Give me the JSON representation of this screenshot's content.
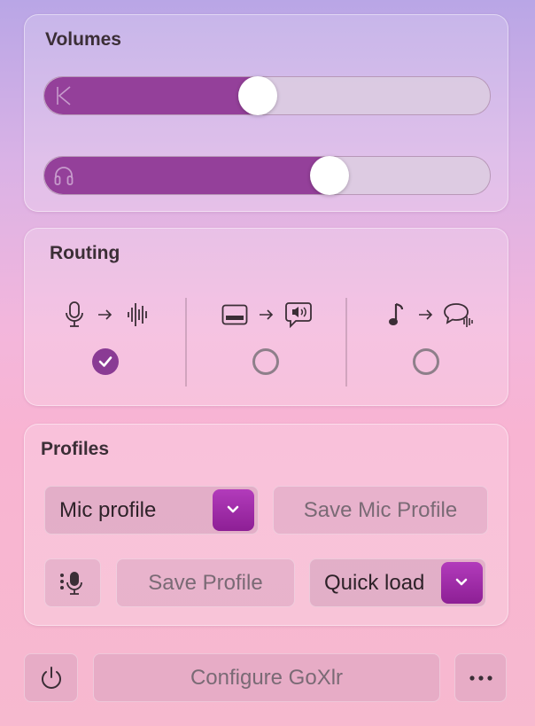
{
  "volumes": {
    "title": "Volumes",
    "sliders": [
      {
        "name": "system-volume",
        "icon": "k-icon",
        "level": 0.48
      },
      {
        "name": "headphones-volume",
        "icon": "headphones-icon",
        "level": 0.64
      }
    ]
  },
  "routing": {
    "title": "Routing",
    "routes": [
      {
        "from_icon": "microphone-icon",
        "to_icon": "waveform-icon",
        "selected": true
      },
      {
        "from_icon": "monitor-icon",
        "to_icon": "speaker-bubble-icon",
        "selected": false
      },
      {
        "from_icon": "music-note-icon",
        "to_icon": "chat-waveform-icon",
        "selected": false
      }
    ]
  },
  "profiles": {
    "title": "Profiles",
    "mic_profile_select": "Mic profile",
    "save_mic_profile": "Save Mic Profile",
    "save_profile": "Save Profile",
    "quick_load_select": "Quick load"
  },
  "footer": {
    "configure": "Configure GoXlr"
  },
  "colors": {
    "accent": "#94409a",
    "chevron_accent": "#a02ca8"
  }
}
